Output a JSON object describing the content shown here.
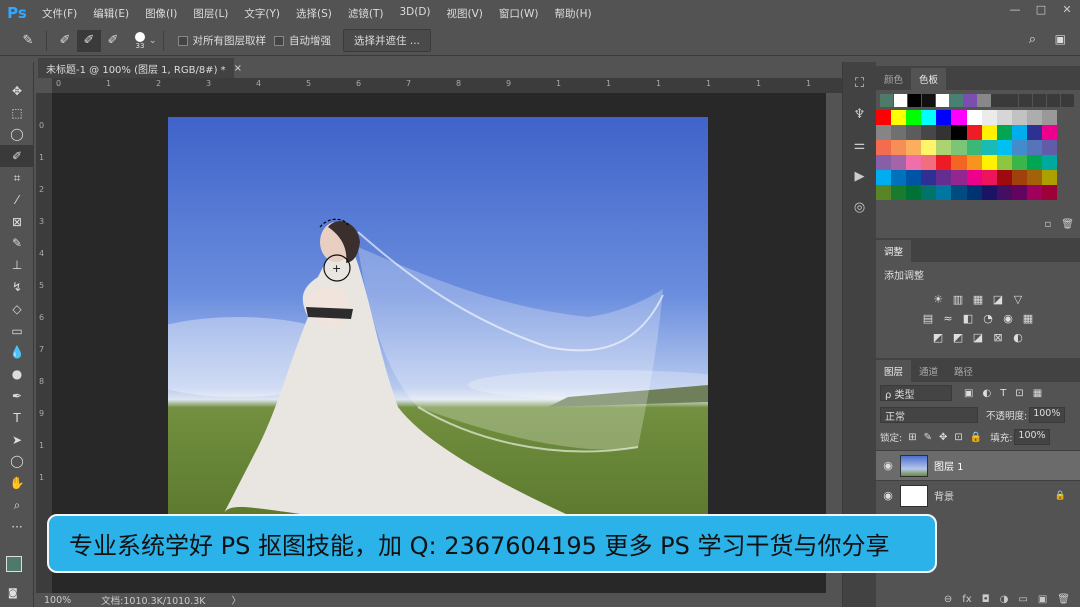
{
  "app": {
    "logo": "Ps"
  },
  "menu": [
    "文件(F)",
    "编辑(E)",
    "图像(I)",
    "图层(L)",
    "文字(Y)",
    "选择(S)",
    "滤镜(T)",
    "3D(D)",
    "视图(V)",
    "窗口(W)",
    "帮助(H)"
  ],
  "window_controls": [
    "—",
    "□",
    "✕"
  ],
  "options": {
    "brush_size": "33",
    "sample_all_layers": "对所有图层取样",
    "auto_enhance": "自动增强",
    "refine_button": "选择并遮住 ..."
  },
  "tools": [
    "move-icon",
    "marquee-icon",
    "lasso-icon",
    "quick-selection-icon",
    "crop-icon",
    "eyedropper-icon",
    "healing-brush-icon",
    "brush-icon",
    "clone-stamp-icon",
    "history-brush-icon",
    "eraser-icon",
    "gradient-icon",
    "blur-icon",
    "dodge-icon",
    "pen-icon",
    "type-icon",
    "path-selection-icon",
    "shape-icon",
    "hand-icon",
    "zoom-icon",
    "more-icon"
  ],
  "document": {
    "tab_title": "未标题-1 @ 100% (图层 1, RGB/8#) *",
    "close": "×"
  },
  "ruler_h": [
    "0",
    "1",
    "2",
    "3",
    "4",
    "5",
    "6",
    "7",
    "8",
    "9",
    "1",
    "1",
    "1",
    "1",
    "1",
    "1"
  ],
  "ruler_v": [
    "0",
    "1",
    "2",
    "3",
    "4",
    "5",
    "6",
    "7",
    "8",
    "9",
    "1",
    "1"
  ],
  "status": {
    "zoom": "100%",
    "doc_info": "文档:1010.3K/1010.3K",
    "arrow": "〉"
  },
  "color_panel": {
    "tabs": [
      "颜色",
      "色板"
    ],
    "active": 1
  },
  "swatches_top": [
    "#4f7a6a",
    "#ffffff",
    "#000000",
    "#111111",
    "#ffffff",
    "#4a7f74",
    "#7a4fb0",
    "#888888",
    "#3a3a3a",
    "#3a3a3a",
    "#3a3a3a",
    "#3a3a3a",
    "#3a3a3a",
    "#3a3a3a"
  ],
  "swatches_grid": [
    [
      "#ff0000",
      "#ffff00",
      "#00ff00",
      "#00ffff",
      "#0000ff",
      "#ff00ff",
      "#ffffff",
      "#ebebeb",
      "#d6d6d6",
      "#c2c2c2",
      "#adadad",
      "#999999"
    ],
    [
      "#858585",
      "#707070",
      "#5c5c5c",
      "#474747",
      "#333333",
      "#000000",
      "#ee1c24",
      "#fff200",
      "#00a651",
      "#00aeef",
      "#2e3192",
      "#ec008c"
    ],
    [
      "#f26c4f",
      "#f68e56",
      "#fbaf5d",
      "#fff568",
      "#acd372",
      "#7cc576",
      "#3bb878",
      "#1abbb4",
      "#00bff3",
      "#438ccb",
      "#5574b9",
      "#605ca8"
    ],
    [
      "#855fa8",
      "#a763a8",
      "#f06ea9",
      "#f26d7d",
      "#ed1c24",
      "#f26522",
      "#f7941d",
      "#fff200",
      "#8dc63f",
      "#39b54a",
      "#00a651",
      "#00a99d"
    ],
    [
      "#00aeef",
      "#0072bc",
      "#0054a6",
      "#2e3192",
      "#662d91",
      "#92278f",
      "#ec008c",
      "#ed145b",
      "#9e0b0f",
      "#a0410d",
      "#a36209",
      "#aba000"
    ],
    [
      "#598527",
      "#1a7b30",
      "#007236",
      "#00746b",
      "#0076a3",
      "#004b80",
      "#003471",
      "#1b1464",
      "#440e62",
      "#630460",
      "#9e005d",
      "#9e0039"
    ]
  ],
  "adjust_panel": {
    "tab": "调整",
    "title": "添加调整",
    "row1": [
      "☀",
      "▥",
      "▦",
      "◪",
      "▽"
    ],
    "row2": [
      "▤",
      "≈",
      "◧",
      "◔",
      "◉",
      "▦"
    ],
    "row3": [
      "◩",
      "◩",
      "◪",
      "⊠",
      "◐"
    ]
  },
  "layers_panel": {
    "tabs": [
      "图层",
      "通道",
      "路径"
    ],
    "filter": "ρ 类型",
    "blend": "正常",
    "opacity_label": "不透明度:",
    "opacity": "100%",
    "lock_label": "锁定:",
    "fill_label": "填充:",
    "fill": "100%",
    "layers": [
      {
        "name": "图层 1",
        "selected": true
      },
      {
        "name": "背景",
        "locked": true
      }
    ],
    "footer": [
      "⊖",
      "fx",
      "◘",
      "◑",
      "▭",
      "▣",
      "🗑"
    ]
  },
  "banner": {
    "text": "专业系统学好 PS 抠图技能，加 Q: 2367604195  更多 PS 学习干货与你分享"
  },
  "foreground_color": "#4f7a6a",
  "background_color": "#ffffff"
}
